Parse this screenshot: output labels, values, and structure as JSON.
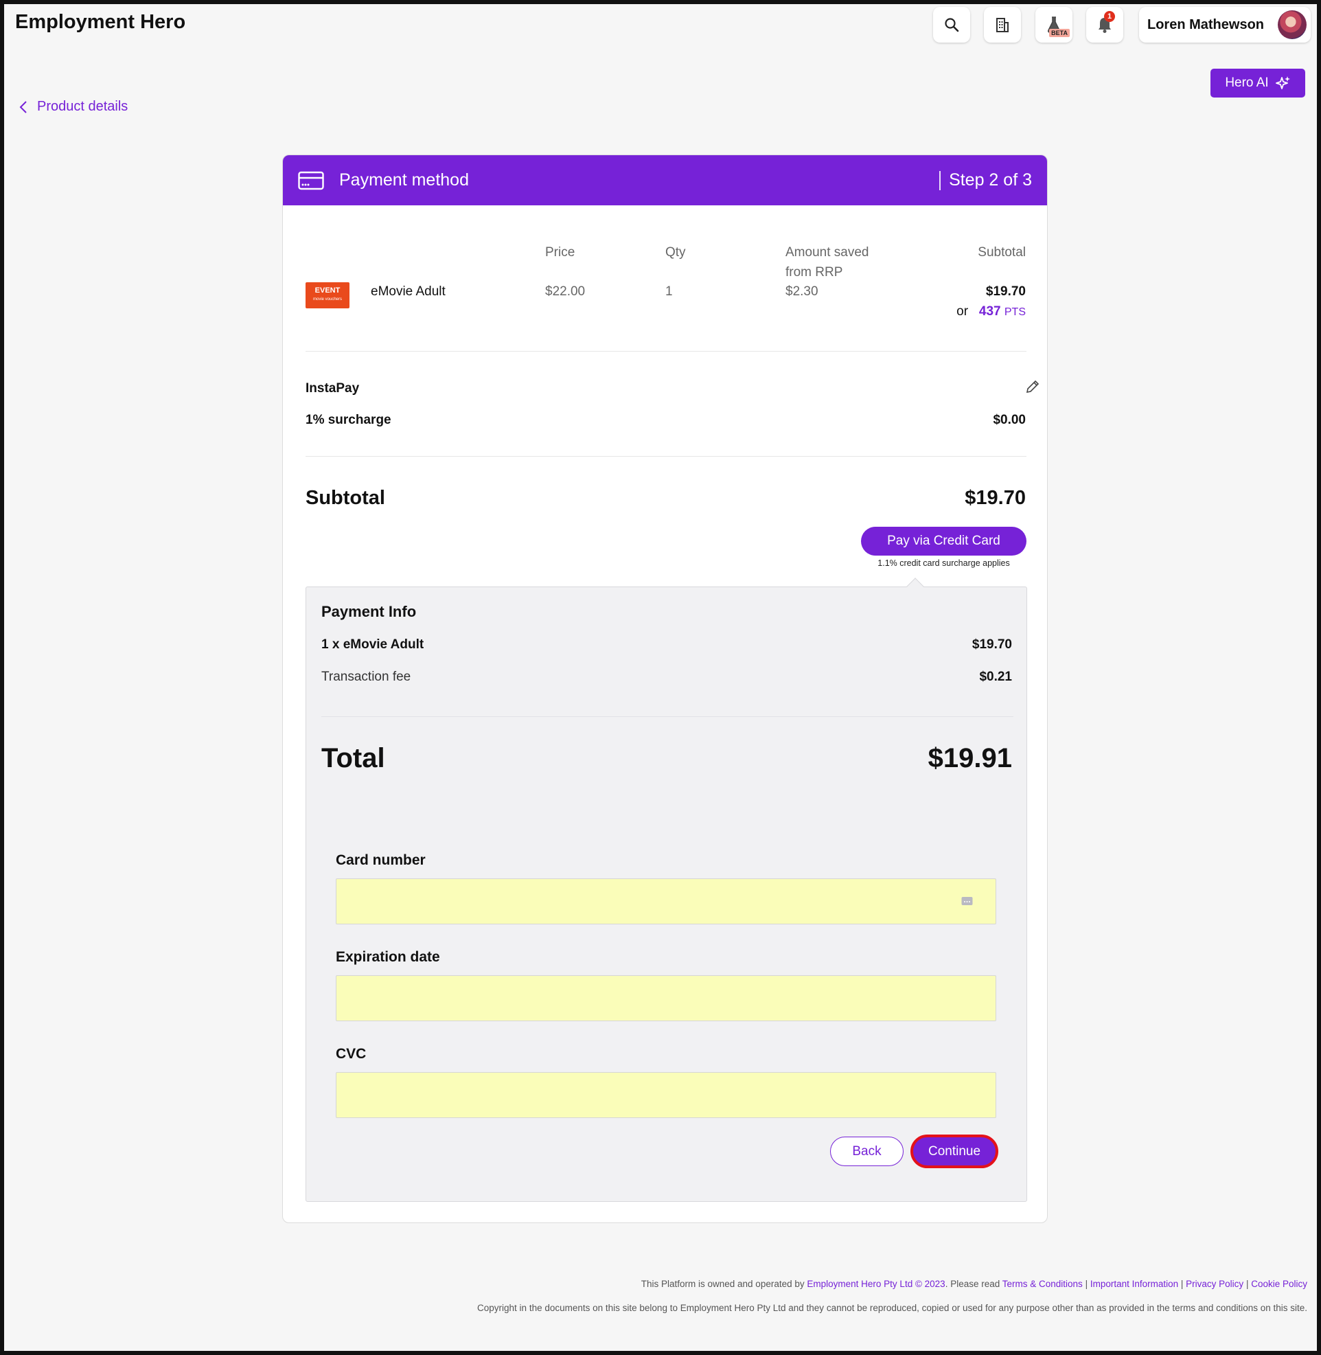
{
  "app": {
    "brand": "Employment Hero"
  },
  "topbar": {
    "beta_label": "BETA",
    "notification_count": "1",
    "user_name": "Loren Mathewson"
  },
  "hero_ai": {
    "label": "Hero AI"
  },
  "breadcrumb": {
    "back_label": "Product details"
  },
  "card": {
    "title": "Payment method",
    "step": "Step 2 of 3"
  },
  "order_table": {
    "headers": {
      "price": "Price",
      "qty": "Qty",
      "saved": "Amount saved from RRP",
      "subtotal": "Subtotal"
    },
    "row": {
      "product_logo_text": "EVENT",
      "product_logo_sub": "movie vouchers",
      "name": "eMovie Adult",
      "price": "$22.00",
      "qty": "1",
      "saved": "$2.30",
      "subtotal": "$19.70",
      "or_label": "or",
      "points": "437",
      "points_unit": "PTS"
    }
  },
  "instapay": {
    "label": "InstaPay",
    "surcharge_label": "1% surcharge",
    "surcharge_value": "$0.00"
  },
  "summary": {
    "subtotal_label": "Subtotal",
    "subtotal_value": "$19.70",
    "pay_button": "Pay via Credit Card",
    "pay_note": "1.1% credit card surcharge applies"
  },
  "payment_info": {
    "title": "Payment Info",
    "item_label": "1 x eMovie Adult",
    "item_value": "$19.70",
    "fee_label": "Transaction fee",
    "fee_value": "$0.21",
    "total_label": "Total",
    "total_value": "$19.91"
  },
  "form": {
    "card_number_label": "Card number",
    "expiration_label": "Expiration date",
    "cvc_label": "CVC",
    "back_button": "Back",
    "continue_button": "Continue"
  },
  "footer": {
    "line1_prefix": "This Platform is owned and operated by",
    "company_link": "Employment Hero Pty Ltd © 2023",
    "line1_mid": ". Please read",
    "terms": "Terms & Conditions",
    "important": "Important Information",
    "privacy": "Privacy Policy",
    "cookie": "Cookie Policy",
    "line2": "Copyright in the documents on this site belong to Employment Hero Pty Ltd and they cannot be reproduced, copied or used for any purpose other than as provided in the terms and conditions on this site."
  },
  "colors": {
    "accent": "#7622d7",
    "autofill": "#fafdb9",
    "focus_ring": "#e4121a"
  }
}
